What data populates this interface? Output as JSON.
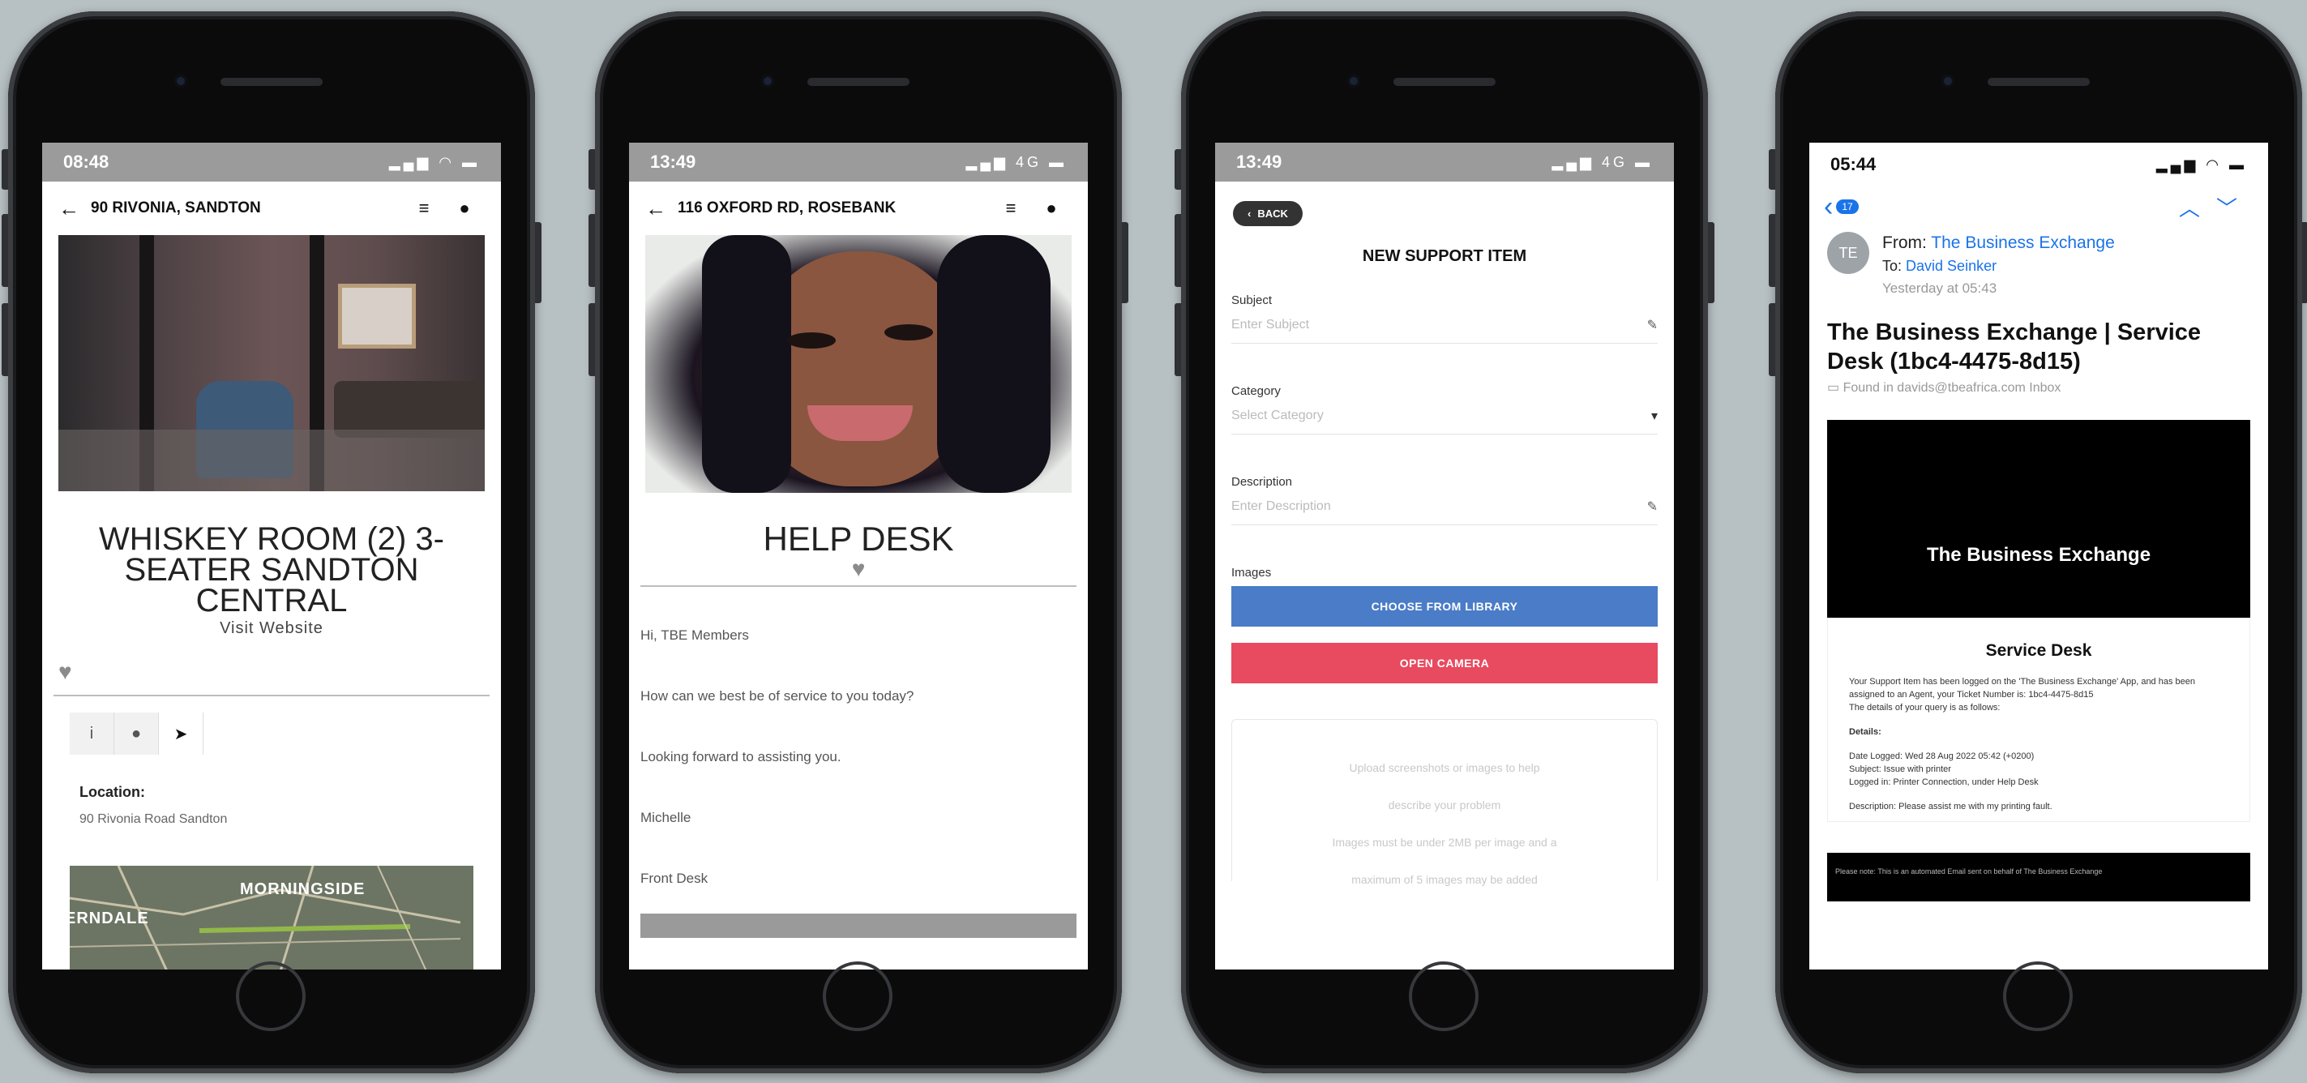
{
  "phones": [
    {
      "status_time": "08:48",
      "address": "90 RIVONIA, SANDTON",
      "title": "WHISKEY ROOM (2) 3-SEATER SANDTON CENTRAL",
      "visit": "Visit Website",
      "location_label": "Location:",
      "location_value": "90 Rivonia Road Sandton",
      "map_labels": [
        "MORNINGSIDE",
        "ERNDALE"
      ]
    },
    {
      "status_time": "13:49",
      "address": "116 OXFORD RD, ROSEBANK",
      "title": "HELP DESK",
      "messages": [
        "Hi, TBE Members",
        "How can we best be of service to you today?",
        "Looking forward to assisting you.",
        "Michelle",
        "Front Desk"
      ]
    },
    {
      "status_time": "13:49",
      "back": "BACK",
      "title": "NEW SUPPORT ITEM",
      "subject_label": "Subject",
      "subject_placeholder": "Enter Subject",
      "category_label": "Category",
      "category_placeholder": "Select Category",
      "description_label": "Description",
      "description_placeholder": "Enter Description",
      "images_label": "Images",
      "choose_btn": "CHOOSE FROM LIBRARY",
      "camera_btn": "OPEN CAMERA",
      "hint1": "Upload screenshots or images to help",
      "hint2": "describe your problem",
      "hint3": "Images must be under 2MB per image and a",
      "hint4": "maximum of 5 images may be added",
      "colors": {
        "choose": "#4a7cc7",
        "camera": "#e84a5f"
      }
    },
    {
      "status_time": "05:44",
      "badge": "17",
      "avatar": "TE",
      "from_label": "From:",
      "from": "The Business Exchange",
      "to_label": "To:",
      "to": "David Seinker",
      "date": "Yesterday at 05:43",
      "subject": "The Business Exchange | Service Desk (1bc4-4475-8d15)",
      "found": "Found in davids@tbeafrica.com Inbox",
      "banner": "The Business Exchange",
      "service_desk": "Service Desk",
      "body1": "Your Support Item has been logged on the 'The Business Exchange' App, and has been assigned to an Agent, your Ticket Number is: 1bc4-4475-8d15",
      "body2": "The details of your query is as follows:",
      "details_label": "Details:",
      "detail1": "Date Logged: Wed 28 Aug 2022 05:42 (+0200)",
      "detail2": "Subject: Issue with printer",
      "detail3": "Logged in: Printer Connection, under Help Desk",
      "detail4": "Description: Please assist me with my printing fault.",
      "footer": "Please note: This is an automated Email sent on behalf of The Business Exchange"
    }
  ]
}
